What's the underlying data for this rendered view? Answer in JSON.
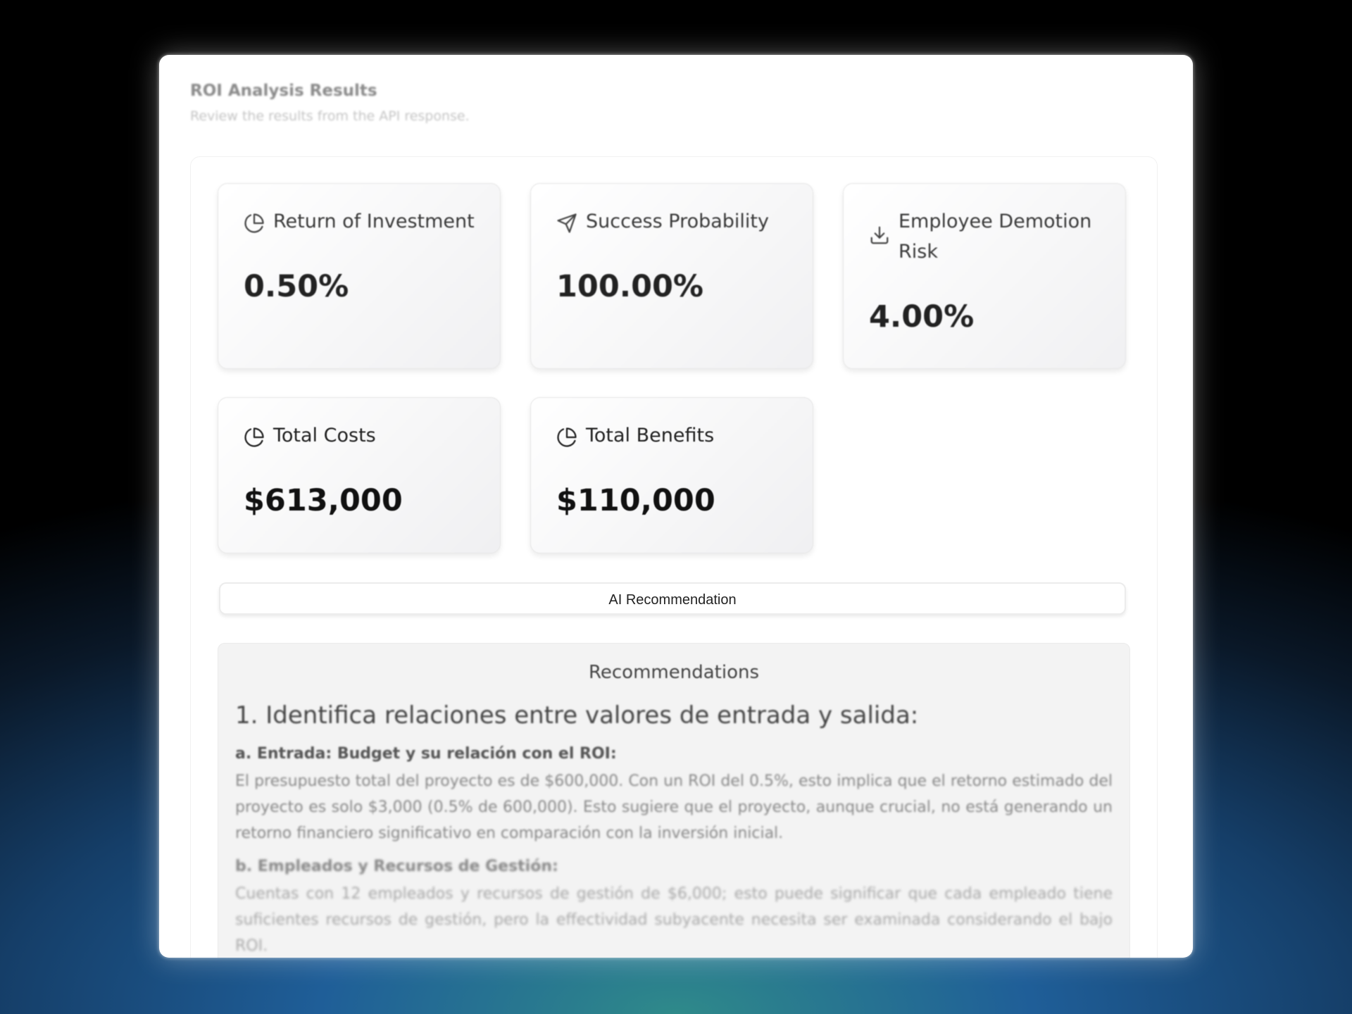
{
  "header": {
    "title": "ROI Analysis Results",
    "subtitle": "Review the results from the API response."
  },
  "metrics": [
    {
      "label": "Return of Investment",
      "value": "0.50%",
      "icon": "pie-chart-icon"
    },
    {
      "label": "Success Probability",
      "value": "100.00%",
      "icon": "send-icon"
    },
    {
      "label": "Employee Demotion Risk",
      "value": "4.00%",
      "icon": "download-icon"
    },
    {
      "label": "Total Costs",
      "value": "$613,000",
      "icon": "pie-chart-icon"
    },
    {
      "label": "Total Benefits",
      "value": "$110,000",
      "icon": "pie-chart-icon"
    }
  ],
  "ai_button": {
    "label": "AI Recommendation"
  },
  "recommendations": {
    "title": "Recommendations",
    "heading": "1. Identifica relaciones entre valores de entrada y salida:",
    "sections": [
      {
        "subheading": "a. Entrada: Budget y su relación con el ROI:",
        "text": "El presupuesto total del proyecto es de $600,000. Con un ROI del 0.5%, esto implica que el retorno estimado del proyecto es solo $3,000 (0.5% de 600,000). Esto sugiere que el proyecto, aunque crucial, no está generando un retorno financiero significativo en comparación con la inversión inicial."
      },
      {
        "subheading": "b. Empleados y Recursos de Gestión:",
        "text": "Cuentas con 12 empleados y recursos de gestión de $6,000; esto puede significar que cada empleado tiene suficientes recursos de gestión, pero la effectividad subyacente necesita ser examinada considerando el bajo ROI."
      }
    ]
  }
}
